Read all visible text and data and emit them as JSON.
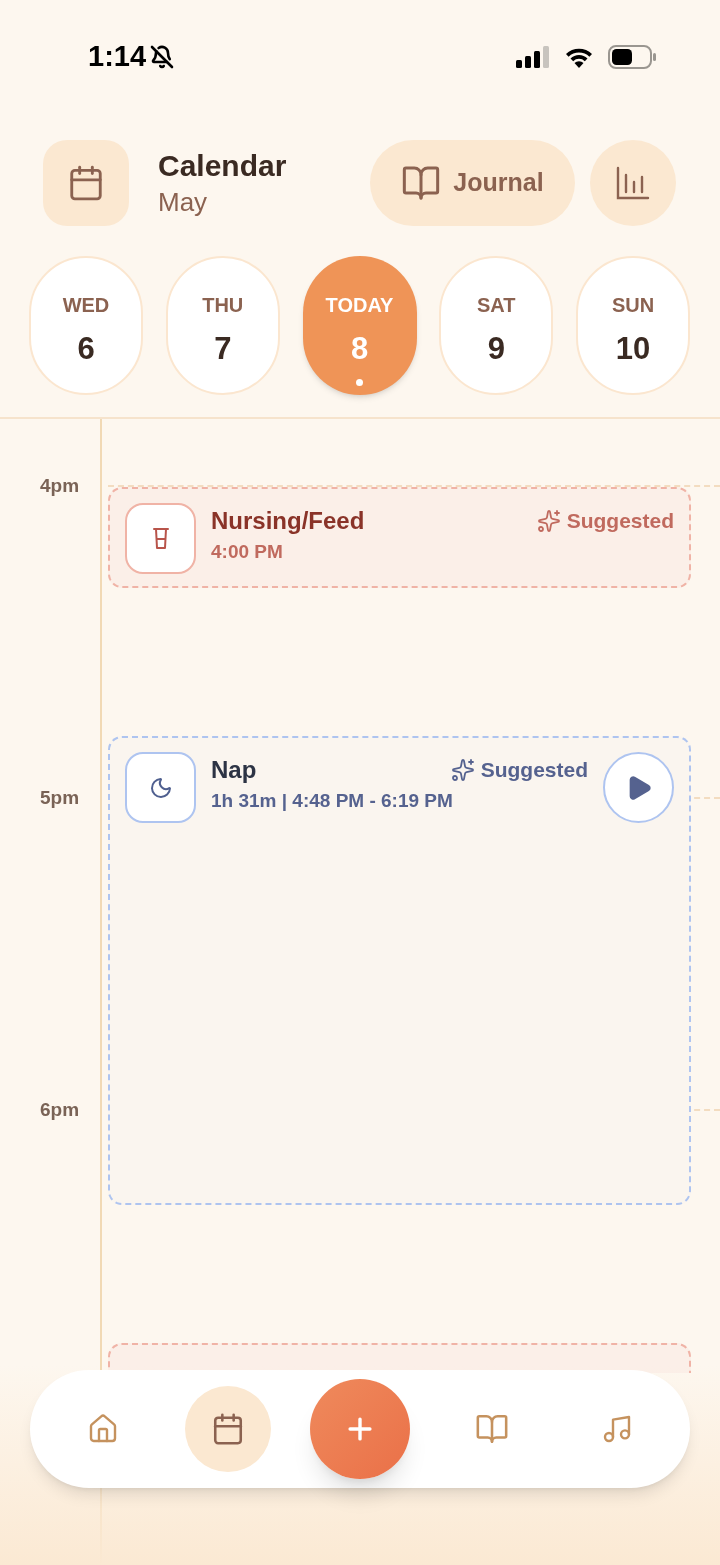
{
  "status_bar": {
    "time": "1:14"
  },
  "header": {
    "title": "Calendar",
    "subtitle": "May",
    "journal_button": "Journal"
  },
  "days": [
    {
      "weekday": "WED",
      "date": "6",
      "selected": false
    },
    {
      "weekday": "THU",
      "date": "7",
      "selected": false
    },
    {
      "weekday": "TODAY",
      "date": "8",
      "selected": true
    },
    {
      "weekday": "SAT",
      "date": "9",
      "selected": false
    },
    {
      "weekday": "SUN",
      "date": "10",
      "selected": false
    }
  ],
  "hours": [
    "4pm",
    "5pm",
    "6pm"
  ],
  "events": [
    {
      "kind": "feed",
      "title": "Nursing/Feed",
      "time": "4:00 PM",
      "badge": "Suggested"
    },
    {
      "kind": "nap",
      "title": "Nap",
      "time": "1h 31m | 4:48 PM - 6:19 PM",
      "badge": "Suggested",
      "playable": true
    },
    {
      "kind": "feed"
    }
  ],
  "nav": [
    {
      "kind": "home",
      "selected": false
    },
    {
      "kind": "calendar",
      "selected": true
    },
    {
      "kind": "add",
      "selected": false
    },
    {
      "kind": "journal",
      "selected": false
    },
    {
      "kind": "music",
      "selected": false
    }
  ]
}
